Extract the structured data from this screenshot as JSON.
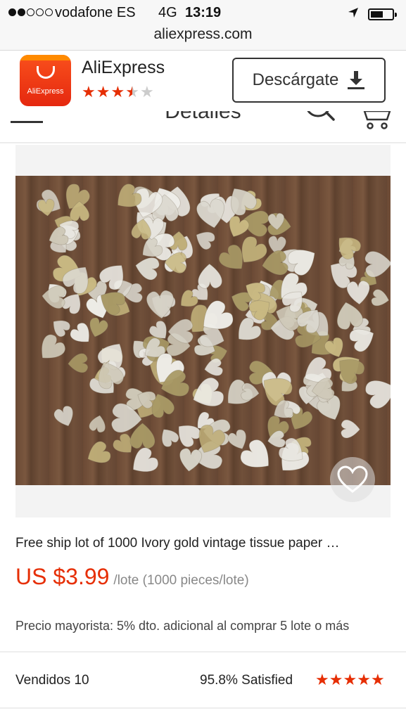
{
  "status_bar": {
    "carrier": "vodafone ES",
    "network": "4G",
    "time": "13:19",
    "signal_bars_filled": 2,
    "signal_bars_total": 5
  },
  "browser": {
    "url": "aliexpress.com"
  },
  "app_banner": {
    "icon_text": "AliExpress",
    "app_name": "AliExpress",
    "rating_stars": 3.5,
    "download_label": "Descárgate",
    "accent": "#e62e04"
  },
  "site_header": {
    "title": "Detalles"
  },
  "product": {
    "title": "Free ship lot of 1000 Ivory gold vintage tissue paper …",
    "price": "US $3.99",
    "unit": "/lote (1000 pieces/lote)",
    "wholesale_note": "Precio mayorista: 5% dto. adicional al comprar 5 lote o más",
    "sold": "Vendidos 10",
    "satisfied": "95.8% Satisfied",
    "rating_stars": 5
  },
  "colors": {
    "price": "#e62e04",
    "star_on": "#e62e04",
    "star_off": "#cccccc"
  }
}
